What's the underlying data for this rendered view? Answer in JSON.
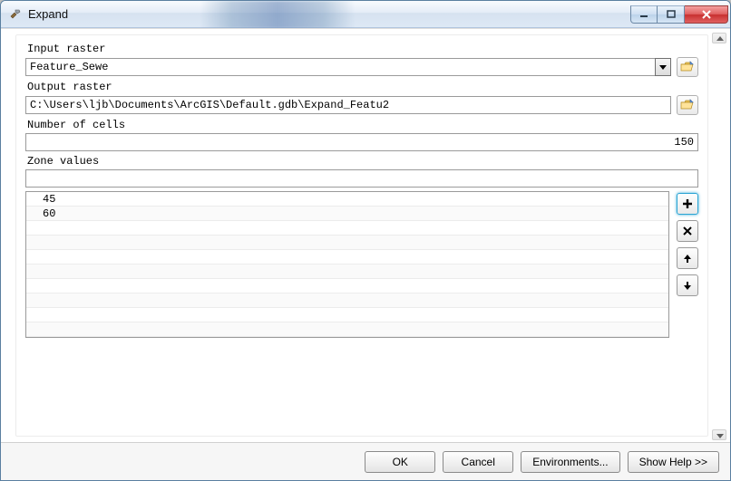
{
  "window": {
    "title": "Expand"
  },
  "fields": {
    "input_raster_label": "Input raster",
    "input_raster_value": "Feature_Sewe",
    "output_raster_label": "Output raster",
    "output_raster_value": "C:\\Users\\ljb\\Documents\\ArcGIS\\Default.gdb\\Expand_Featu2",
    "num_cells_label": "Number of cells",
    "num_cells_value": "150",
    "zone_values_label": "Zone values",
    "zone_values_input": ""
  },
  "zone_values": [
    "45",
    "60"
  ],
  "icons": {
    "app": "hammer-icon",
    "browse": "folder-open-icon",
    "add": "plus",
    "remove": "x",
    "up": "arrow-up",
    "down": "arrow-down",
    "dropdown": "chevron-down"
  },
  "footer": {
    "ok": "OK",
    "cancel": "Cancel",
    "environments": "Environments...",
    "show_help": "Show Help >>"
  }
}
